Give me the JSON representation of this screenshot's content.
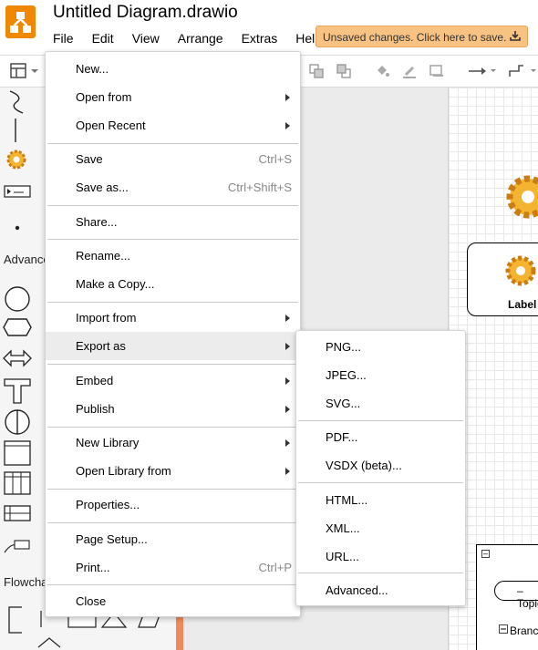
{
  "app": {
    "doc_title": "Untitled Diagram.drawio",
    "unsaved_notice": "Unsaved changes. Click here to save.",
    "brand_color": "#f08705"
  },
  "menubar": [
    "File",
    "Edit",
    "View",
    "Arrange",
    "Extras",
    "Help"
  ],
  "left_panel": {
    "section_advanced": "Advanced",
    "section_flowchart": "Flowchart"
  },
  "canvas": {
    "card_label": "Label",
    "topic_label": "Topic",
    "branch_label": "Branch"
  },
  "file_menu": {
    "new": "New...",
    "open_from": "Open from",
    "open_recent": "Open Recent",
    "save": "Save",
    "save_shortcut": "Ctrl+S",
    "save_as": "Save as...",
    "save_as_shortcut": "Ctrl+Shift+S",
    "share": "Share...",
    "rename": "Rename...",
    "make_copy": "Make a Copy...",
    "import_from": "Import from",
    "export_as": "Export as",
    "embed": "Embed",
    "publish": "Publish",
    "new_library": "New Library",
    "open_library_from": "Open Library from",
    "properties": "Properties...",
    "page_setup": "Page Setup...",
    "print": "Print...",
    "print_shortcut": "Ctrl+P",
    "close": "Close"
  },
  "export_menu": {
    "png": "PNG...",
    "jpeg": "JPEG...",
    "svg": "SVG...",
    "pdf": "PDF...",
    "vsdx": "VSDX (beta)...",
    "html": "HTML...",
    "xml": "XML...",
    "url": "URL...",
    "advanced": "Advanced..."
  }
}
